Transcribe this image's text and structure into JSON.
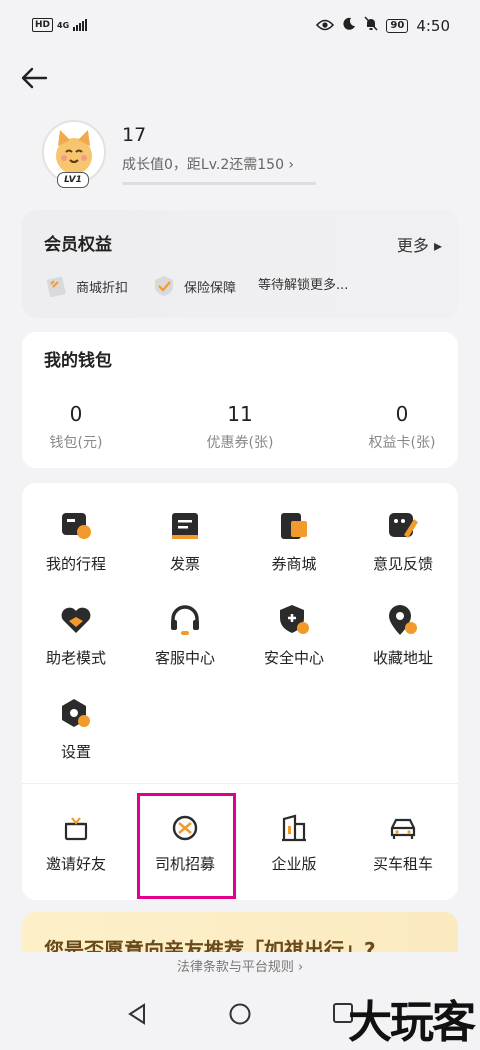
{
  "status_bar": {
    "hd": "HD",
    "network": "4G",
    "battery": "90",
    "time": "4:50"
  },
  "profile": {
    "username": "17",
    "level_badge": "LV1",
    "growth_text": "成长值0，距Lv.2还需150 ›",
    "growth_progress": 0
  },
  "member": {
    "title": "会员权益",
    "more": "更多 ▸",
    "perks": [
      "商城折扣",
      "保险保障",
      "等待解锁更多..."
    ]
  },
  "wallet": {
    "title": "我的钱包",
    "items": [
      {
        "value": "0",
        "label": "钱包(元)"
      },
      {
        "value": "11",
        "label": "优惠券(张)"
      },
      {
        "value": "0",
        "label": "权益卡(张)"
      }
    ]
  },
  "services": {
    "items": [
      "我的行程",
      "发票",
      "券商城",
      "意见反馈",
      "助老模式",
      "客服中心",
      "安全中心",
      "收藏地址",
      "设置"
    ],
    "extra": [
      "邀请好友",
      "司机招募",
      "企业版",
      "买车租车"
    ]
  },
  "banner": {
    "text": "您是否愿意向亲友推荐「如祺出行」?"
  },
  "footer": {
    "text": "法律条款与平台规则 ›"
  },
  "watermark": "大玩客",
  "colors": {
    "accent": "#f39a2c",
    "highlight": "#e3008d",
    "icon_dark": "#2b2b2b"
  }
}
